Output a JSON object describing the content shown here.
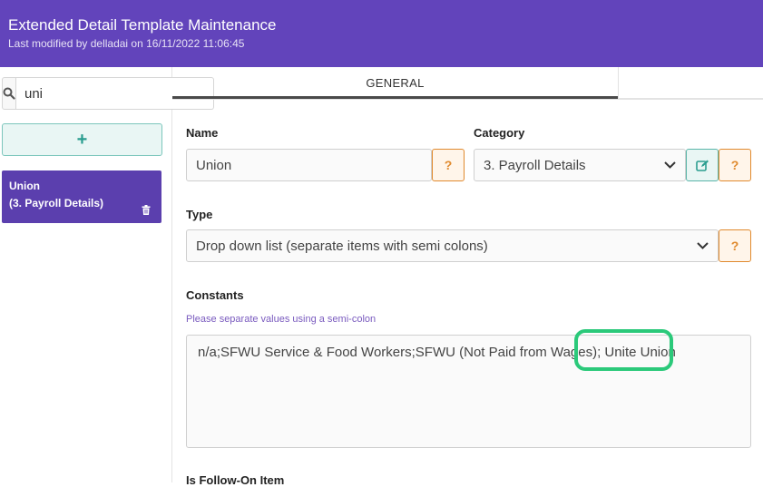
{
  "header": {
    "title": "Extended Detail Template Maintenance",
    "subtitle": "Last modified by delladai on 16/11/2022 11:06:45",
    "background": "#6244bb"
  },
  "sidebar": {
    "search": {
      "icon": "search-icon",
      "value": "uni"
    },
    "add_button": {
      "icon": "plus-icon",
      "label": "+"
    },
    "items": [
      {
        "name": "Union",
        "category": "(3. Payroll Details)",
        "icon": "trash-icon"
      }
    ]
  },
  "tabs": [
    {
      "label": "GENERAL",
      "active": true
    },
    {
      "label": "",
      "active": false
    }
  ],
  "form": {
    "name": {
      "label": "Name",
      "value": "Union",
      "help": "?"
    },
    "category": {
      "label": "Category",
      "value": "3. Payroll Details",
      "help": "?",
      "edit_icon": "edit-icon"
    },
    "type": {
      "label": "Type",
      "value": "Drop down list (separate items with semi colons)",
      "help": "?"
    },
    "constants": {
      "label": "Constants",
      "hint": "Please separate values using a semi-colon",
      "value": "n/a;SFWU Service & Food Workers;SFWU (Not Paid from Wages); Unite Union"
    },
    "follow_on": {
      "label": "Is Follow-On Item"
    }
  },
  "colors": {
    "accent": "#6244bb",
    "teal": "#2a9d8f",
    "orange": "#e08a2e",
    "highlight": "#2bc97a"
  }
}
